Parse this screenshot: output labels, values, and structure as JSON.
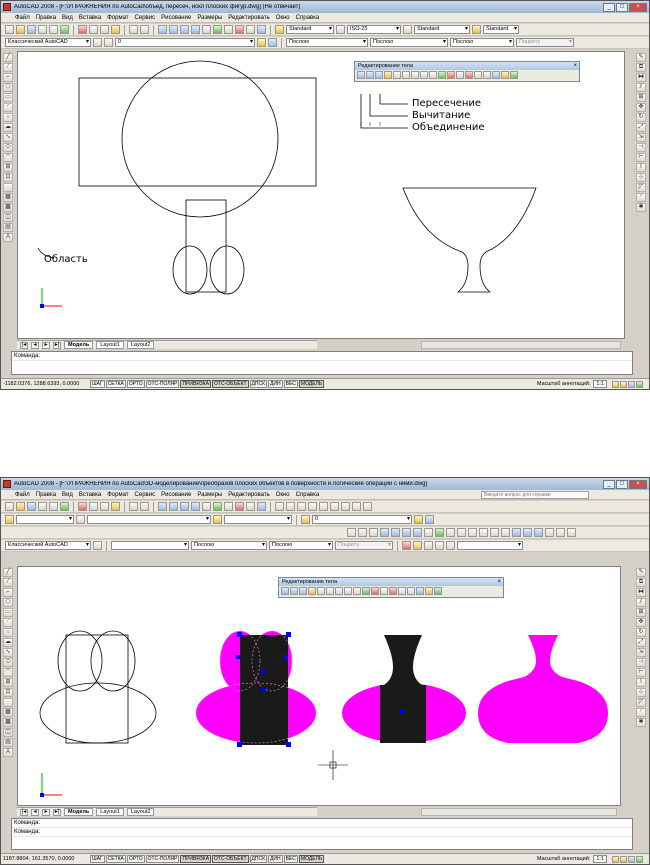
{
  "window1": {
    "title": "AutoCAD 2008 - [F:\\УПРАЖНЕНИЯ по AutoCad\\объед, пересеч, искл плоских фигур.dwg] (Не отвечает)",
    "menu": [
      "Файл",
      "Правка",
      "Вид",
      "Вставка",
      "Формат",
      "Сервис",
      "Рисование",
      "Размеры",
      "Редактировать",
      "Окно",
      "Справка"
    ],
    "styles": {
      "text_style": "Standard",
      "dim_style": "ISO-25",
      "table_style": "Standard",
      "mleader_style": "Standard"
    },
    "workspace": "Классический AutoCAD",
    "layer": "0",
    "props": {
      "color": "Послою",
      "linetype": "Послою",
      "lineweight": "Послою",
      "plotstyle": "Поцвету"
    },
    "panel_title": "Редактирование тела",
    "annotations": {
      "intersect": "Пересечение",
      "subtract": "Вычитание",
      "union": "Объединение",
      "region": "Область"
    },
    "tabs": [
      "Модель",
      "Layout1",
      "Layout2"
    ],
    "command_prompt": "Команда:",
    "coords": "-1182.0376, 1288.6393, 0.0000",
    "status_buttons": [
      "ШАГ",
      "СЕТКА",
      "ОРТО",
      "ОТС-ПОЛЯР",
      "ПРИВЯЗКА",
      "ОТС-ОБЪЕКТ",
      "ДПСК",
      "ДИН",
      "ВЕС",
      "МОДЕЛЬ"
    ],
    "annotation_scale_label": "Масштаб аннотаций:",
    "annotation_scale": "1:1"
  },
  "window2": {
    "title": "AutoCAD 2008 - [F:\\УПРАЖНЕНИЯ по AutoCad\\3D-моделирование\\преобразов плоских объектов в поверхности и логические операции с ними.dwg]",
    "menu": [
      "Файл",
      "Правка",
      "Вид",
      "Вставка",
      "Формат",
      "Сервис",
      "Рисование",
      "Размеры",
      "Редактировать",
      "Окно",
      "Справка"
    ],
    "search_placeholder": "Введите вопрос для справки",
    "workspace": "Классический AutoCAD",
    "layer": "0",
    "props": {
      "linetype": "Послою",
      "lineweight": "Послою",
      "plotstyle": "Поцвету"
    },
    "panel_title": "Редактирование тела",
    "tabs": [
      "Модель",
      "Layout1",
      "Layout2"
    ],
    "command_prompt_1": "Команда:",
    "command_prompt_2": "Команда:",
    "coords": "1187.8804, 161.3570, 0.0000",
    "status_buttons": [
      "ШАГ",
      "СЕТКА",
      "ОРТО",
      "ОТС-ПОЛЯР",
      "ПРИВЯЗКА",
      "ОТС-ОБЪЕКТ",
      "ДПСК",
      "ДИН",
      "ВЕС",
      "МОДЕЛЬ"
    ],
    "annotation_scale_label": "Масштаб аннотаций:",
    "annotation_scale": "1:1"
  },
  "colors": {
    "region_fill": "#ff00ff",
    "selection_fill": "#1a1a1a",
    "grip": "#0000ff",
    "ucs_x": "#ff0000",
    "ucs_y": "#00aa00"
  },
  "window_buttons": {
    "minimize": "_",
    "restore": "□",
    "close": "×"
  },
  "tab_arrows": [
    "|◂",
    "◂",
    "▸",
    "▸|"
  ]
}
